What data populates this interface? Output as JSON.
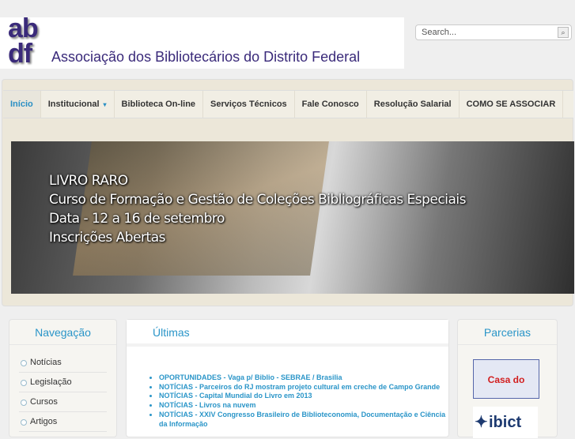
{
  "header": {
    "logo_mark": "ab df",
    "logo_text": "Associação dos Bibliotecários do Distrito Federal",
    "search_placeholder": "Search..."
  },
  "nav": [
    {
      "label": "Início",
      "active": true
    },
    {
      "label": "Institucional",
      "has_dropdown": true
    },
    {
      "label": "Biblioteca On-line"
    },
    {
      "label": "Serviços Técnicos"
    },
    {
      "label": "Fale Conosco"
    },
    {
      "label": "Resolução Salarial"
    },
    {
      "label": "COMO SE ASSOCIAR"
    }
  ],
  "banner": {
    "lines": [
      "LIVRO RARO",
      "Curso de Formação e Gestão  de Coleções Bibliográficas Especiais",
      "Data - 12 a 16 de setembro",
      "Inscrições Abertas"
    ]
  },
  "navegacao": {
    "title": "Navegação",
    "items": [
      "Notícias",
      "Legislação",
      "Cursos",
      "Artigos"
    ]
  },
  "ultimas": {
    "title": "Últimas",
    "items": [
      {
        "cat": "OPORTUNIDADES",
        "title": "Vaga p/ Biblio - SEBRAE / Brasilia"
      },
      {
        "cat": "NOTÍCIAS",
        "title": "Parceiros do RJ mostram projeto cultural em creche de Campo Grande"
      },
      {
        "cat": "NOTÍCIAS",
        "title": "Capital Mundial do Livro em 2013"
      },
      {
        "cat": "NOTÍCIAS",
        "title": "Livros na nuvem"
      },
      {
        "cat": "NOTÍCIAS",
        "title": "XXIV Congresso Brasileiro de Biblioteconomia, Documentação e Ciência da Informação"
      }
    ]
  },
  "parcerias": {
    "title": "Parcerias",
    "partners": [
      "Casa do Saber",
      "ibict"
    ]
  }
}
